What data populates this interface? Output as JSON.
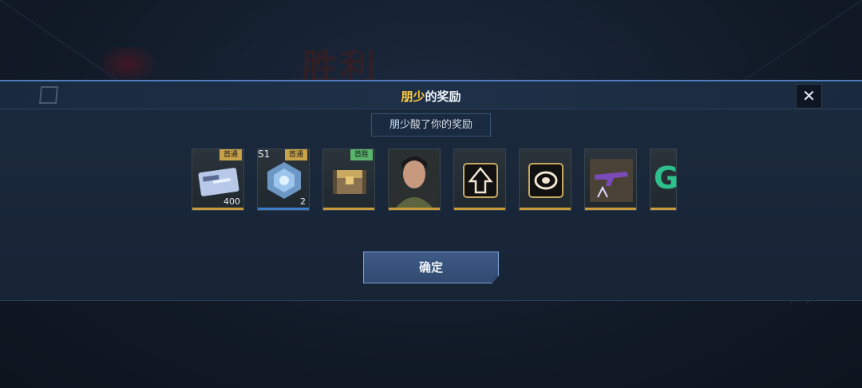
{
  "background": {
    "title": "胜利"
  },
  "dialog": {
    "title_name": "朋少",
    "title_rest": "的奖励",
    "subtitle_name": "朋少",
    "subtitle_rest": "酸了你的奖励",
    "close_label": "✕",
    "confirm_label": "确定"
  },
  "rewards": [
    {
      "name": "credit-card-reward",
      "tag": "首通",
      "quantity": "400"
    },
    {
      "name": "blue-crystal-reward",
      "season": "S1",
      "tag": "首通",
      "quantity": "2"
    },
    {
      "name": "gold-chest-reward",
      "tag": "首胜"
    },
    {
      "name": "character-portrait-reward"
    },
    {
      "name": "rank-emblem-reward"
    },
    {
      "name": "badge-reward"
    },
    {
      "name": "weapon-skin-reward"
    },
    {
      "name": "partial-letter-reward",
      "glyph": "G"
    }
  ],
  "colors": {
    "accent": "#ffcb3d",
    "panel_border": "#4f7dbd",
    "tag_gold": "#c8a24a",
    "tag_green": "#5ab46e"
  }
}
